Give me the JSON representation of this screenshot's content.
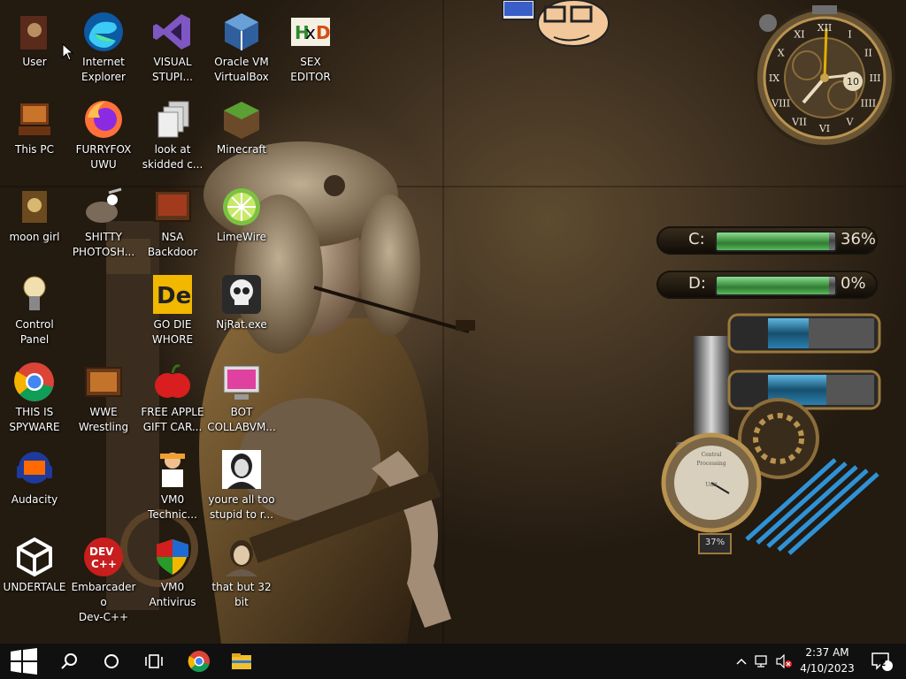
{
  "desktop": {
    "icons": [
      {
        "label": "User",
        "icon": "user-folder-icon"
      },
      {
        "label": "Internet\nExplorer",
        "icon": "edge-icon"
      },
      {
        "label": "VISUAL\nSTUPI...",
        "icon": "visual-studio-icon"
      },
      {
        "label": "Oracle VM\nVirtualBox",
        "icon": "virtualbox-icon"
      },
      {
        "label": "SEX\nEDITOR",
        "icon": "hxd-icon"
      },
      {
        "label": "This PC",
        "icon": "this-pc-icon"
      },
      {
        "label": "FURRYFOX\nUWU",
        "icon": "firefox-icon"
      },
      {
        "label": "look at\nskidded c...",
        "icon": "file-stack-icon"
      },
      {
        "label": "Minecraft",
        "icon": "minecraft-icon"
      },
      {
        "label": "moon girl",
        "icon": "moon-girl-icon"
      },
      {
        "label": "SHITTY\nPHOTOSH...",
        "icon": "gimp-icon"
      },
      {
        "label": "NSA\nBackdoor",
        "icon": "nsa-backdoor-icon"
      },
      {
        "label": "LimeWire",
        "icon": "limewire-icon"
      },
      {
        "label": "Control Panel",
        "icon": "control-panel-icon"
      },
      {
        "label": "GO DIE\nWHORE",
        "icon": "de-app-icon"
      },
      {
        "label": "NjRat.exe",
        "icon": "skull-icon"
      },
      {
        "label": "THIS IS\nSPYWARE",
        "icon": "chrome-icon"
      },
      {
        "label": "WWE\nWrestling",
        "icon": "wwe-tv-icon"
      },
      {
        "label": "FREE APPLE\nGIFT CAR...",
        "icon": "apple-icon"
      },
      {
        "label": "BOT\nCOLLABVM...",
        "icon": "bot-collabvm-icon"
      },
      {
        "label": "Audacity",
        "icon": "audacity-icon"
      },
      {
        "label": "VM0\nTechnic...",
        "icon": "technician-icon"
      },
      {
        "label": "youre all too\nstupid to r...",
        "icon": "portrait-icon"
      },
      {
        "label": "UNDERTALE",
        "icon": "unity-icon"
      },
      {
        "label": "Embarcadero\nDev-C++",
        "icon": "devcpp-icon"
      },
      {
        "label": "VM0\nAntivirus",
        "icon": "shield-icon"
      },
      {
        "label": "that but 32\nbit",
        "icon": "painting-icon"
      }
    ]
  },
  "gadgets": {
    "clock": {
      "numerals": [
        "XII",
        "I",
        "II",
        "III",
        "IIII",
        "V",
        "VI",
        "VII",
        "VIII",
        "IX",
        "X",
        "XI"
      ],
      "date": "10"
    },
    "drives": [
      {
        "letter": "C:",
        "percent": "36%",
        "fill": 0.36
      },
      {
        "letter": "D:",
        "percent": "0%",
        "fill": 0.0
      }
    ],
    "cpu_meter": {
      "dial_text1": "Central",
      "dial_text2": "Processing",
      "dial_text3": "Unit",
      "value": "37%"
    }
  },
  "taskbar": {
    "start": "windows-start-icon",
    "search": "search-icon",
    "cortana": "cortana-circle-icon",
    "task_view": "task-view-icon",
    "pinned": [
      "chrome-icon",
      "file-explorer-icon"
    ],
    "tray": {
      "time": "2:37 AM",
      "date": "4/10/2023",
      "notifications": "2"
    }
  },
  "colors": {
    "taskbar": "#101010",
    "accent_gold": "#c9a24a"
  }
}
